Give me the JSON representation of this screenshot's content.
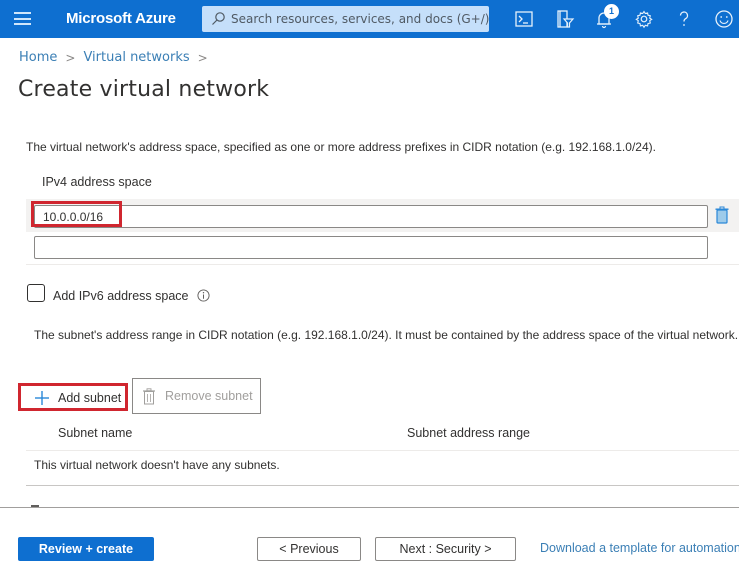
{
  "topbar": {
    "brand": "Microsoft Azure",
    "search_placeholder": "Search resources, services, and docs (G+/)",
    "notification_count": "1",
    "icons": [
      "menu-icon",
      "cloud-shell-icon",
      "directory-filter-icon",
      "notifications-icon",
      "settings-icon",
      "help-icon",
      "feedback-icon"
    ],
    "color": "#0e6fd0"
  },
  "breadcrumb": {
    "items": [
      "Home",
      "Virtual networks"
    ],
    "separator": ">"
  },
  "page": {
    "title": "Create virtual network"
  },
  "address_space": {
    "description": "The virtual network's address space, specified as one or more address prefixes in CIDR notation (e.g. 192.168.1.0/24).",
    "label": "IPv4 address space",
    "values": [
      "10.0.0.0/16",
      ""
    ]
  },
  "ipv6": {
    "label": "Add IPv6 address space",
    "checked": false
  },
  "subnets": {
    "description": "The subnet's address range in CIDR notation (e.g. 192.168.1.0/24). It must be contained by the address space of the virtual network.",
    "add_label": "Add subnet",
    "remove_label": "Remove subnet",
    "columns": [
      "Subnet name",
      "Subnet address range"
    ],
    "rows": [],
    "empty_message": "This virtual network doesn't have any subnets."
  },
  "footer": {
    "review_create": "Review + create",
    "previous": "< Previous",
    "next": "Next : Security >",
    "download_link": "Download a template for automation"
  },
  "highlight_color": "#d0262f"
}
